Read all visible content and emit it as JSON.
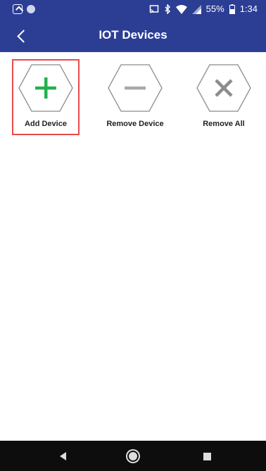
{
  "status_bar": {
    "battery": "55%",
    "time": "1:34",
    "icons": [
      "app-icon",
      "circle-icon",
      "cast-icon",
      "bluetooth-icon",
      "wifi-icon",
      "signal-icon",
      "battery-icon"
    ]
  },
  "app_bar": {
    "title": "IOT Devices",
    "back_icon": "chevron-left-icon",
    "background": "#2c3e94"
  },
  "actions": [
    {
      "label": "Add Device",
      "icon": "plus-icon",
      "icon_color": "#22b14c",
      "selected": true
    },
    {
      "label": "Remove Device",
      "icon": "minus-icon",
      "icon_color": "#a9a9a9",
      "selected": false
    },
    {
      "label": "Remove All",
      "icon": "x-icon",
      "icon_color": "#8c8c8c",
      "selected": false
    }
  ],
  "selection_color": "#e74c4c",
  "nav_bar": {
    "icons": [
      "back-triangle-icon",
      "home-circle-icon",
      "recents-square-icon"
    ]
  }
}
